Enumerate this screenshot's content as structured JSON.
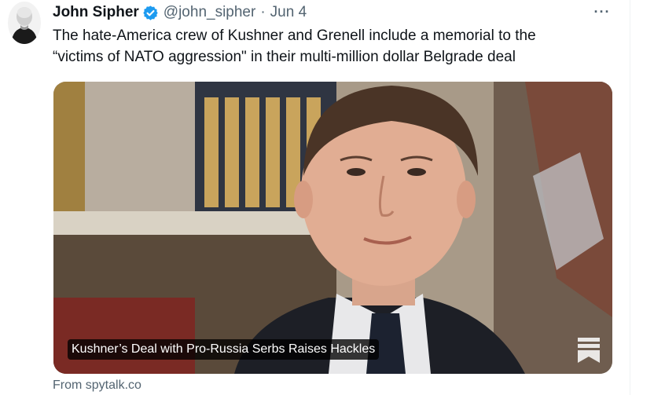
{
  "author": {
    "display_name": "John Sipher",
    "handle": "@john_sipher",
    "separator": "·",
    "date": "Jun 4",
    "verified": true,
    "avatar_icon": "avatar-photo"
  },
  "more_label": "···",
  "tweet": {
    "line1": "The hate-America crew of Kushner and Grenell include a memorial to the",
    "line2": "“victims of NATO aggression\" in their multi-million dollar Belgrade deal"
  },
  "card": {
    "title": "Kushner’s Deal with Pro-Russia Serbs Raises Hackles",
    "bookmark_icon": "bookmark-icon"
  },
  "source": "From spytalk.co",
  "colors": {
    "verified_blue": "#1d9bf0",
    "secondary_text": "#536471",
    "primary_text": "#0f1419"
  }
}
